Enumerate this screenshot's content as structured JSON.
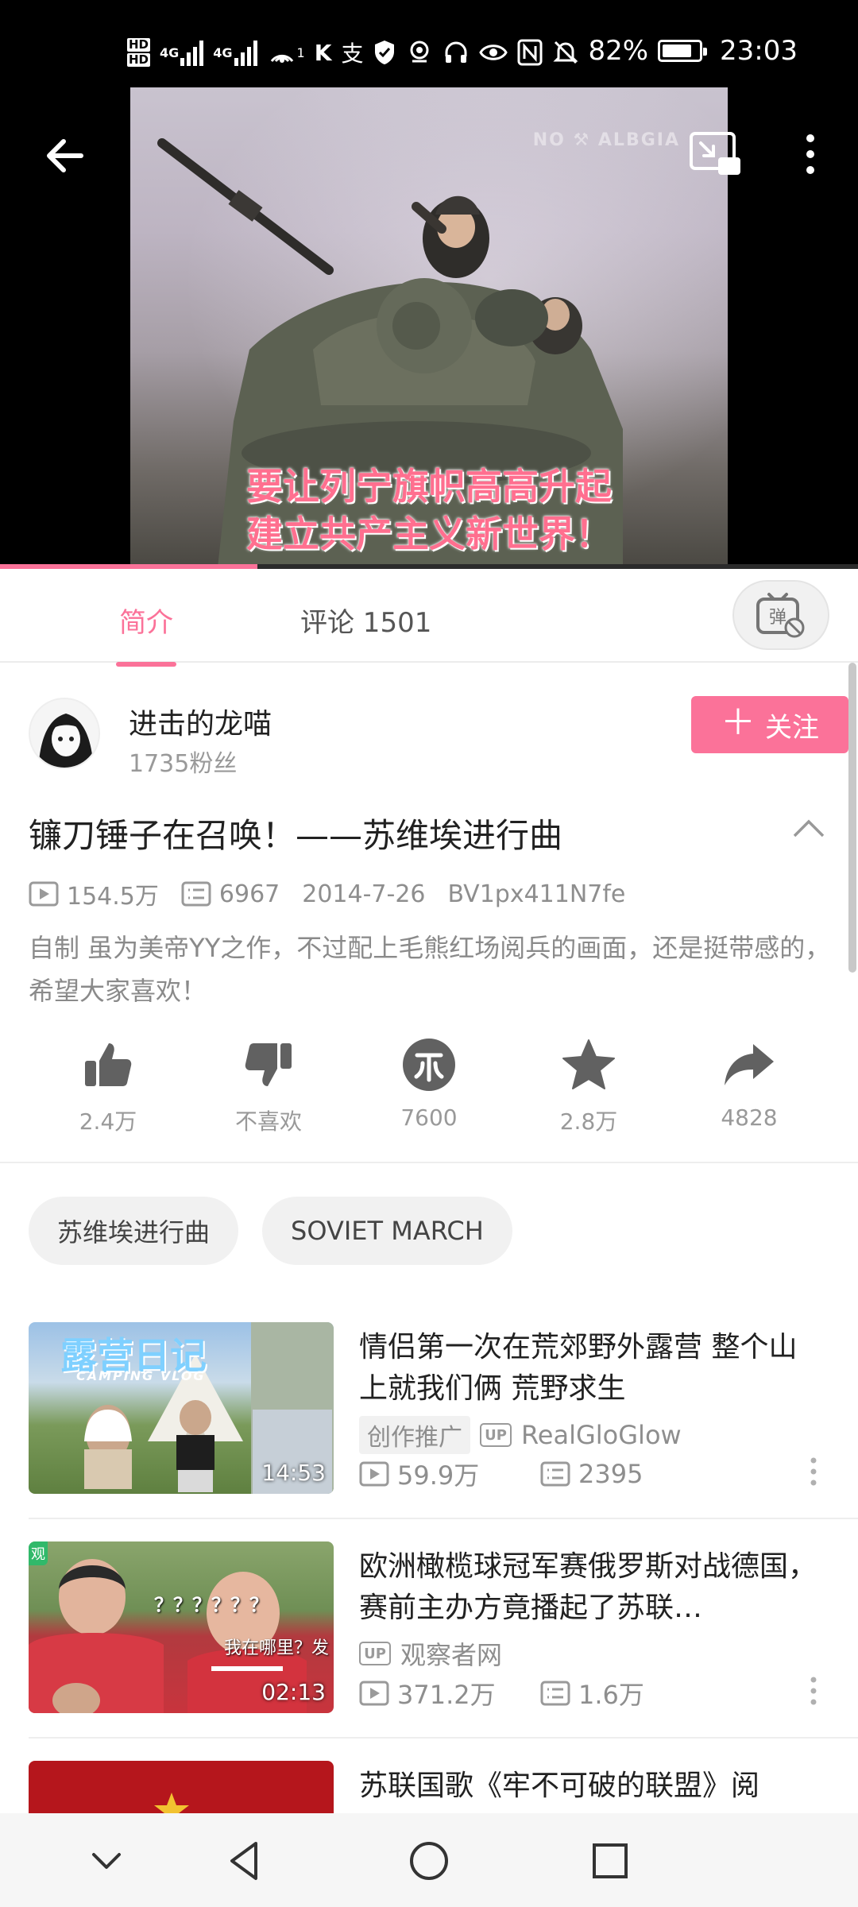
{
  "status_bar": {
    "hd_top": "HD",
    "hd_bottom": "HD",
    "signal1_label": "4G",
    "signal2_label": "4G",
    "hotspot_count": "1",
    "battery": "82%",
    "battery_level": 0.82,
    "time": "23:03"
  },
  "video": {
    "watermark": "NO ⚒ ALBGIA",
    "subtitle_line1": "要让列宁旗帜高高升起",
    "subtitle_line2": "建立共产主义新世界！",
    "progress_fraction": 0.3
  },
  "tabs": {
    "intro": "简介",
    "comments": "评论 1501",
    "danmaku_glyph": "弹"
  },
  "uploader": {
    "name": "进击的龙喵",
    "fans": "1735粉丝",
    "follow_label": "关注"
  },
  "video_info": {
    "title": "镰刀锤子在召唤！——苏维埃进行曲",
    "views": "154.5万",
    "danmaku": "6967",
    "date": "2014-7-26",
    "bvid": "BV1px411N7fe",
    "description": "自制 虽为美帝YY之作，不过配上毛熊红场阅兵的画面，还是挺带感的，希望大家喜欢！"
  },
  "actions": {
    "like": "2.4万",
    "dislike": "不喜欢",
    "coin": "7600",
    "favorite": "2.8万",
    "share": "4828"
  },
  "tags": [
    "苏维埃进行曲",
    "SOVIET MARCH"
  ],
  "related": [
    {
      "title": "情侣第一次在荒郊野外露营 整个山上就我们俩 荒野求生",
      "duration": "14:53",
      "promo_badge": "创作推广",
      "up_badge": "UP",
      "uploader": "RealGloGlow",
      "views": "59.9万",
      "danmaku": "2395",
      "thumb_text": "露营日记",
      "thumb_subtext": "CAMPING VLOG"
    },
    {
      "title": "欧洲橄榄球冠军赛俄罗斯对战德国，赛前主办方竟播起了苏联…",
      "duration": "02:13",
      "up_badge": "UP",
      "uploader": "观察者网",
      "views": "371.2万",
      "danmaku": "1.6万",
      "thumb_text": "？？？？？？",
      "thumb_subtext": "我在哪里？发",
      "thumb_corner": "观"
    },
    {
      "title": "苏联国歌《牢不可破的联盟》阅"
    }
  ],
  "colors": {
    "accent": "#fb7299",
    "text_primary": "#212121",
    "text_secondary": "#8e8e8e"
  },
  "icons": {
    "back": "back-arrow-icon",
    "pip": "picture-in-picture-icon",
    "more": "more-vertical-icon",
    "like": "thumbs-up-icon",
    "dislike": "thumbs-down-icon",
    "coin": "coin-icon",
    "favorite": "star-icon",
    "share": "share-arrow-icon"
  }
}
